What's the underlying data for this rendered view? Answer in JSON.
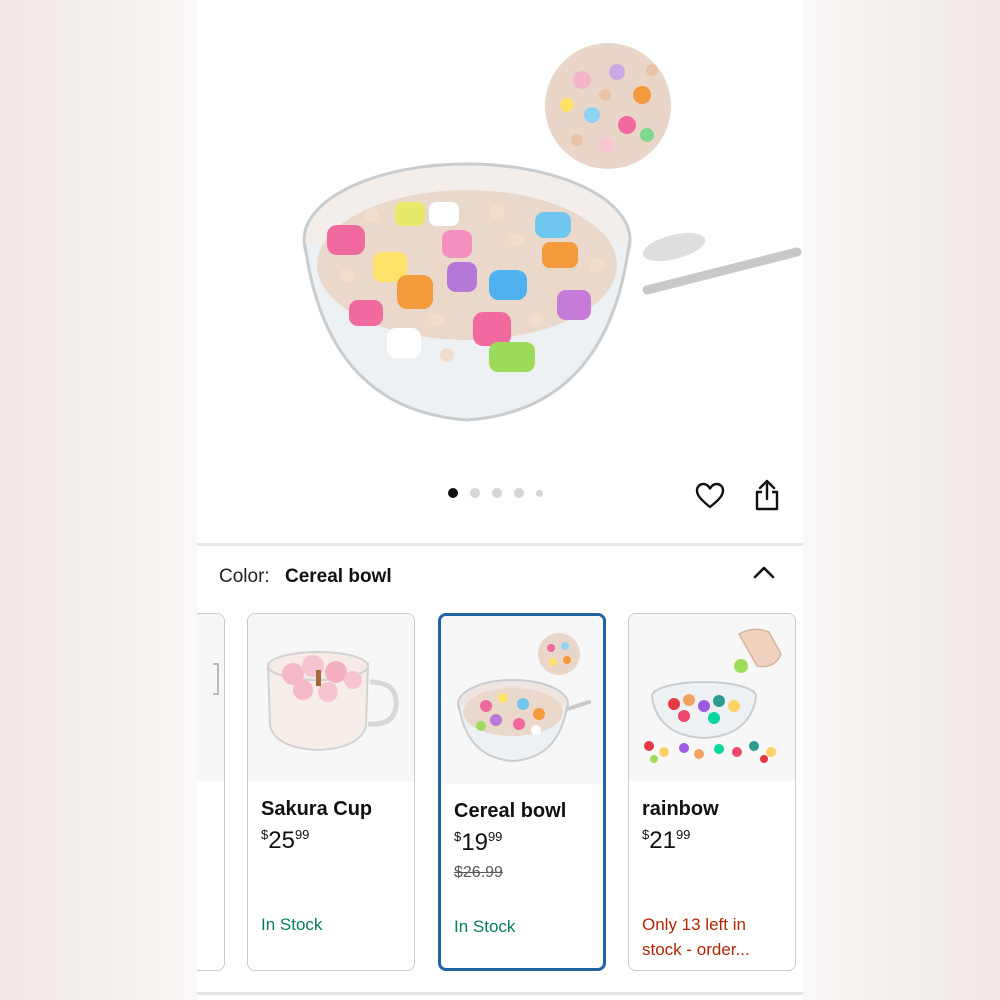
{
  "image_carousel": {
    "dots": 5,
    "active_index": 0
  },
  "variation": {
    "label": "Color:",
    "selected": "Cereal bowl"
  },
  "partial_card": {
    "name": ".."
  },
  "options": [
    {
      "name": "Sakura Cup",
      "price_symbol": "$",
      "price_whole": "25",
      "price_cents": "99",
      "list_price": "",
      "stock": "In Stock",
      "stock_status": "in"
    },
    {
      "name": "Cereal bowl",
      "price_symbol": "$",
      "price_whole": "19",
      "price_cents": "99",
      "list_price": "$26.99",
      "stock": "In Stock",
      "stock_status": "in"
    },
    {
      "name": "rainbow",
      "price_symbol": "$",
      "price_whole": "21",
      "price_cents": "99",
      "list_price": "",
      "stock": "Only 13 left in stock - order...",
      "stock_status": "low"
    }
  ],
  "colors": {
    "selected_border": "#2162a1",
    "in_stock": "#067d62",
    "low_stock": "#b12704"
  }
}
